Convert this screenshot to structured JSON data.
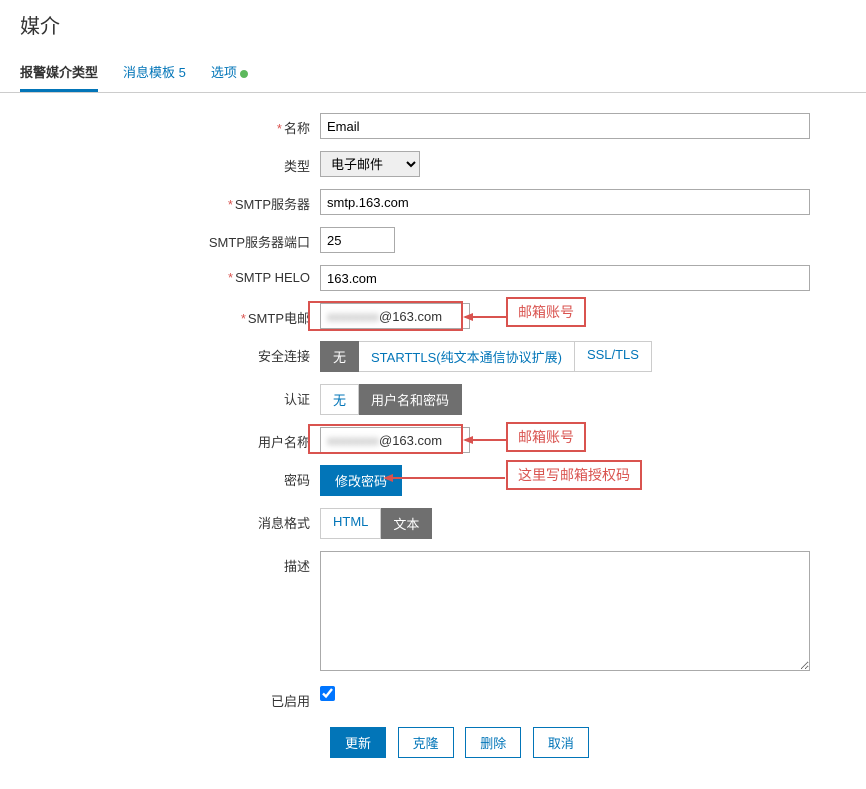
{
  "page_title": "媒介",
  "tabs": {
    "media_type": "报警媒介类型",
    "message_template_label": "消息模板",
    "message_template_count": "5",
    "options": "选项"
  },
  "labels": {
    "name": "名称",
    "type": "类型",
    "smtp_server": "SMTP服务器",
    "smtp_port": "SMTP服务器端口",
    "smtp_helo": "SMTP HELO",
    "smtp_email": "SMTP电邮",
    "security": "安全连接",
    "auth": "认证",
    "username": "用户名称",
    "password": "密码",
    "msg_format": "消息格式",
    "description": "描述",
    "enabled": "已启用"
  },
  "values": {
    "name": "Email",
    "type": "电子邮件",
    "smtp_server": "smtp.163.com",
    "smtp_port": "25",
    "smtp_helo": "163.com",
    "smtp_email_obscured": "xxxxxxxx",
    "smtp_email_suffix": "@163.com",
    "username_obscured": "xxxxxxxx",
    "username_suffix": "@163.com",
    "description": ""
  },
  "segments": {
    "security": {
      "none": "无",
      "starttls": "STARTTLS(纯文本通信协议扩展)",
      "ssl": "SSL/TLS"
    },
    "auth": {
      "none": "无",
      "userpass": "用户名和密码"
    },
    "msg_format": {
      "html": "HTML",
      "text": "文本"
    }
  },
  "buttons": {
    "change_password": "修改密码",
    "update": "更新",
    "clone": "克隆",
    "delete": "删除",
    "cancel": "取消"
  },
  "annotations": {
    "email_account": "邮箱账号",
    "auth_code": "这里写邮箱授权码"
  }
}
